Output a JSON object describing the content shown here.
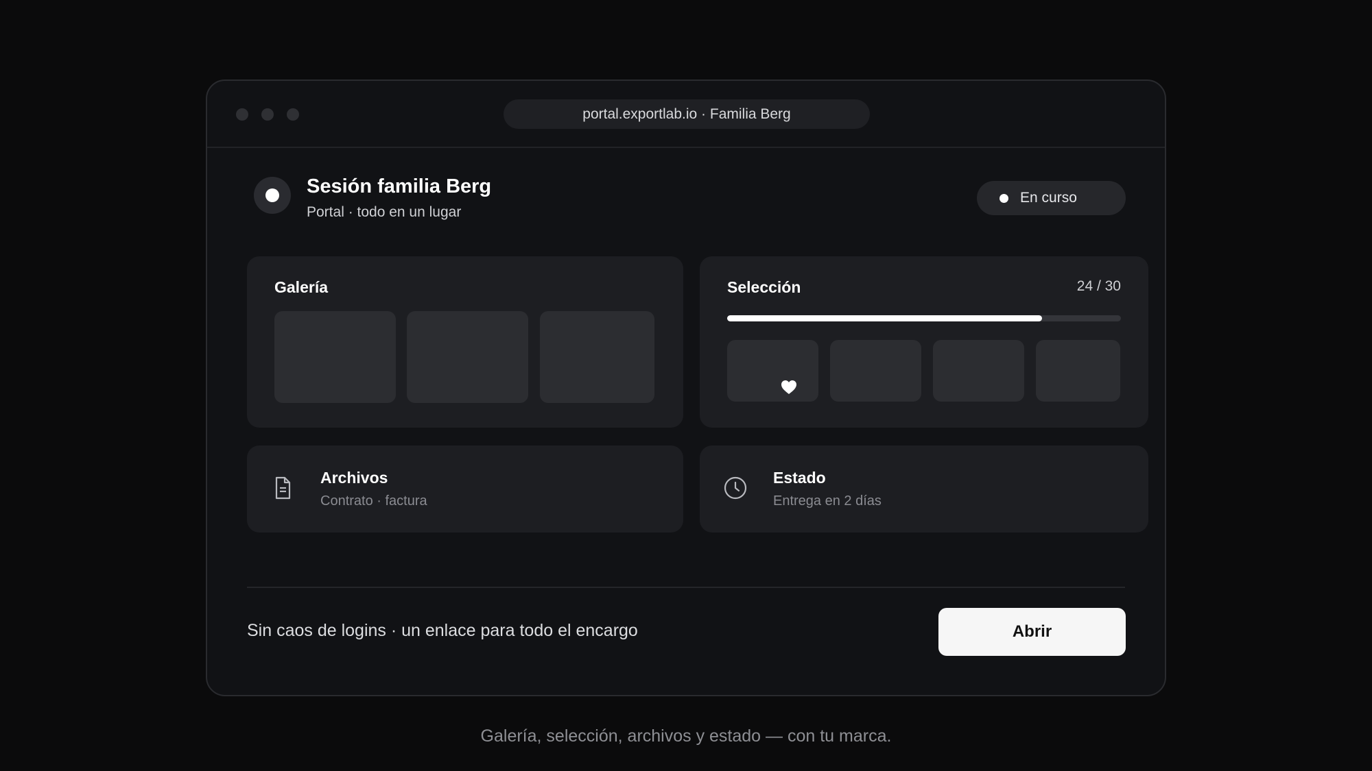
{
  "window": {
    "url_title": "portal.exportlab.io · Familia Berg"
  },
  "header": {
    "title": "Sesión familia Berg",
    "subtitle": "Portal · todo en un lugar",
    "status": "En curso"
  },
  "gallery": {
    "title": "Galería",
    "thumbnail_count": 3
  },
  "selection": {
    "title": "Selección",
    "count_text": "24 / 30",
    "selected": 24,
    "total": 30,
    "progress": 0.8,
    "favorite_icon": "heart-icon"
  },
  "files": {
    "title": "Archivos",
    "subtitle": "Contrato · factura",
    "icon": "document-icon"
  },
  "state": {
    "title": "Estado",
    "subtitle": "Entrega en 2 días",
    "icon": "clock-icon"
  },
  "footer": {
    "text": "Sin caos de logins · un enlace para todo el encargo",
    "open_label": "Abrir"
  },
  "caption": "Galería, selección, archivos y estado — con tu marca.",
  "colors": {
    "background": "#0b0b0c",
    "window": "#111215",
    "card": "#1d1e22",
    "accent": "#ffffff"
  }
}
